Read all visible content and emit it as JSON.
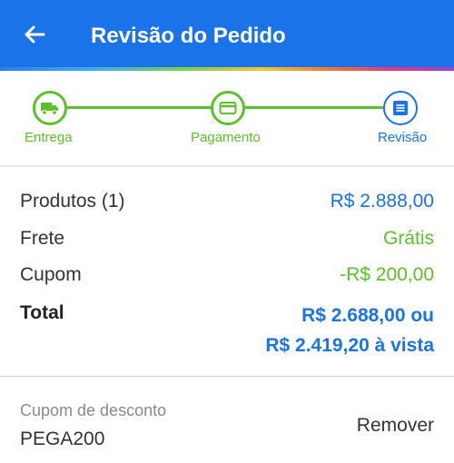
{
  "header": {
    "title": "Revisão do Pedido",
    "back_icon": "arrow-left-icon",
    "background": "#1a73e8"
  },
  "steps": [
    {
      "label": "Entrega",
      "icon": "truck-icon",
      "status": "done",
      "color": "#5bc12a"
    },
    {
      "label": "Pagamento",
      "icon": "credit-card-icon",
      "status": "done",
      "color": "#5bc12a"
    },
    {
      "label": "Revisão",
      "icon": "list-icon",
      "status": "current",
      "color": "#1a73e8"
    }
  ],
  "summary": {
    "products_label": "Produtos (1)",
    "products_value": "R$ 2.888,00",
    "shipping_label": "Frete",
    "shipping_value": "Grátis",
    "coupon_label": "Cupom",
    "coupon_value": "-R$ 200,00",
    "total_label": "Total",
    "total_value_line1": "R$ 2.688,00 ou",
    "total_value_line2": "R$ 2.419,20 à vista"
  },
  "coupon": {
    "label": "Cupom de desconto",
    "code": "PEGA200",
    "remove_label": "Remover"
  },
  "colors": {
    "blue": "#1a73e8",
    "green": "#5bc12a"
  }
}
